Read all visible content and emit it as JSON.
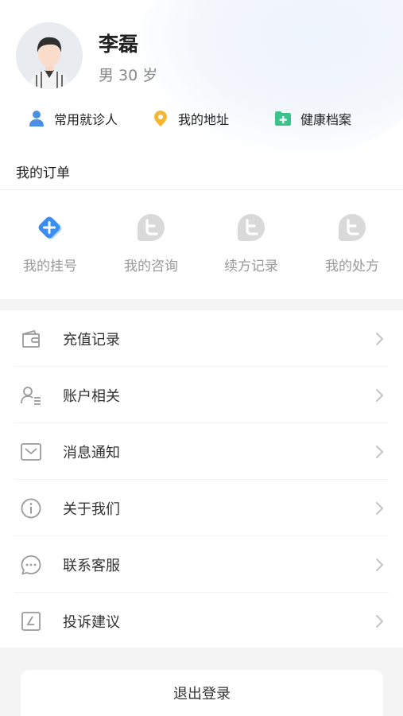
{
  "profile": {
    "name": "李磊",
    "meta": "男 30 岁"
  },
  "quick_links": [
    {
      "label": "常用就诊人",
      "icon": "person-icon",
      "color": "#4a90e2"
    },
    {
      "label": "我的地址",
      "icon": "location-pin-icon",
      "color": "#f5b731"
    },
    {
      "label": "健康档案",
      "icon": "health-folder-icon",
      "color": "#3cc38c"
    }
  ],
  "orders": {
    "title": "我的订单",
    "items": [
      {
        "label": "我的挂号",
        "icon": "register-icon",
        "active": true
      },
      {
        "label": "我的咨询",
        "icon": "consult-icon",
        "active": false
      },
      {
        "label": "续方记录",
        "icon": "renewal-icon",
        "active": false
      },
      {
        "label": "我的处方",
        "icon": "prescription-icon",
        "active": false
      }
    ]
  },
  "menu": [
    {
      "label": "充值记录",
      "icon": "wallet-icon"
    },
    {
      "label": "账户相关",
      "icon": "account-icon"
    },
    {
      "label": "消息通知",
      "icon": "message-icon"
    },
    {
      "label": "关于我们",
      "icon": "info-icon"
    },
    {
      "label": "联系客服",
      "icon": "chat-icon"
    },
    {
      "label": "投诉建议",
      "icon": "feedback-icon"
    }
  ],
  "logout_label": "退出登录",
  "colors": {
    "accent": "#3a8ef0",
    "inactive_icon": "#d9d9d9",
    "text_primary": "#222222",
    "text_secondary": "#999999"
  }
}
